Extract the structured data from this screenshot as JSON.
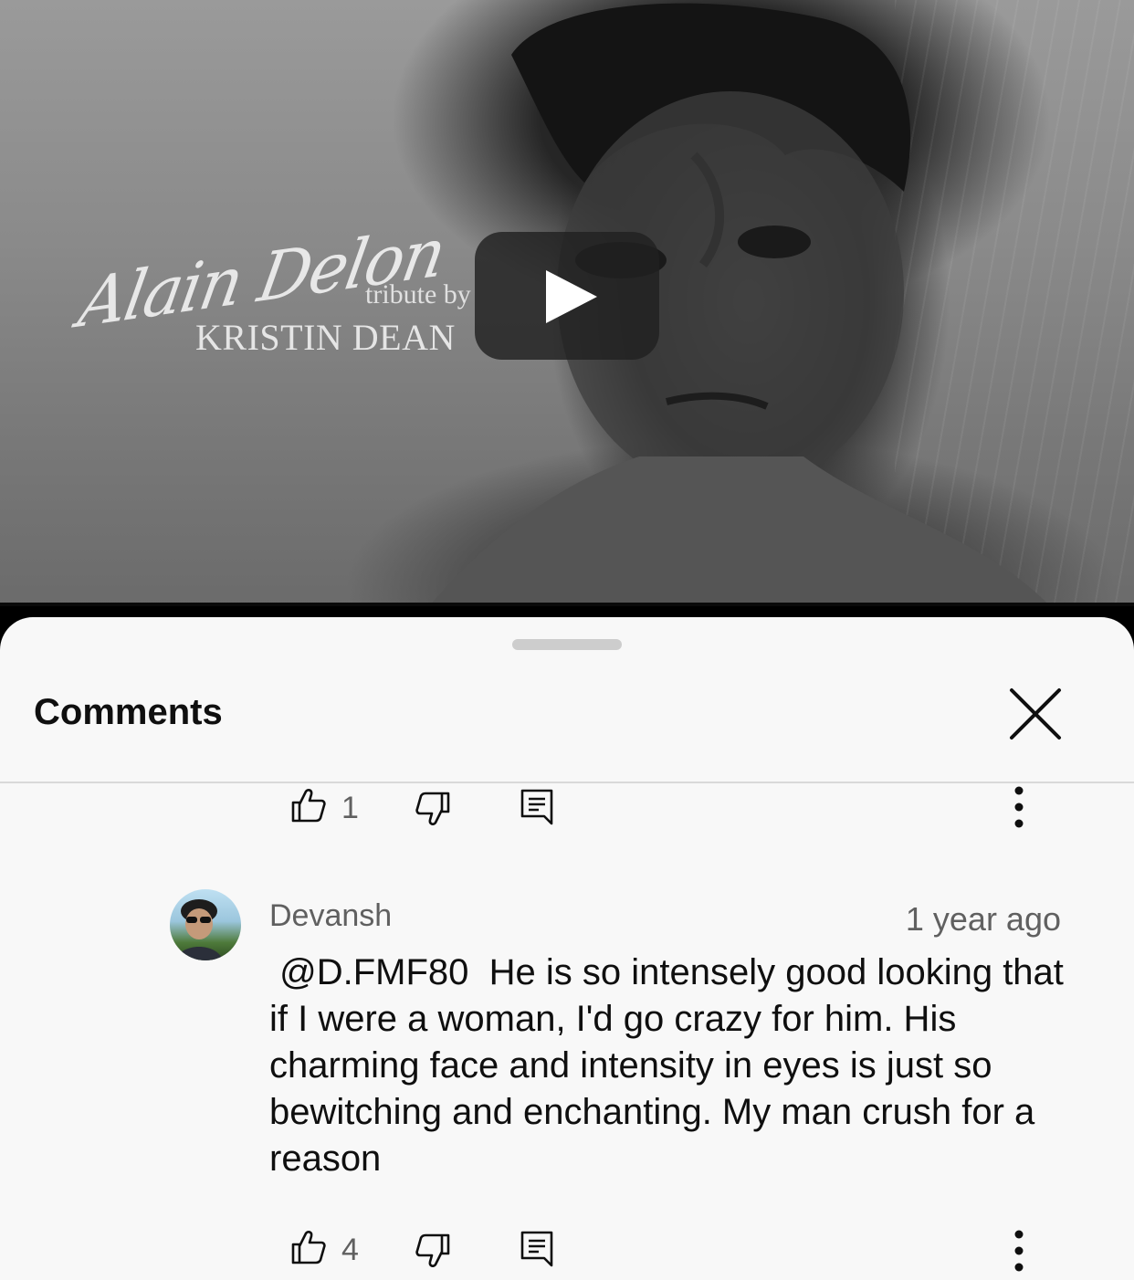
{
  "video": {
    "title_script": "Alain Delon",
    "title_tribute": "tribute by",
    "title_credit": "KRISTIN DEAN"
  },
  "sheet": {
    "title": "Comments"
  },
  "prev_comment": {
    "like_count": "1"
  },
  "comment": {
    "author": "Devansh",
    "timestamp": "1 year ago",
    "text": " @D.FMF80  He is so intensely good looking that if I were a woman, I'd go crazy for him. His charming face and intensity in eyes is just so bewitching and enchanting. My man crush for a reason",
    "like_count": "4"
  },
  "colors": {
    "sheet_bg": "#f8f8f8",
    "text_primary": "#0f0f0f",
    "text_secondary": "#606060",
    "play_button_bg": "#212121"
  },
  "icons": [
    "play-icon",
    "close-icon",
    "thumbs-up-icon",
    "thumbs-down-icon",
    "reply-icon",
    "more-vert-icon"
  ]
}
